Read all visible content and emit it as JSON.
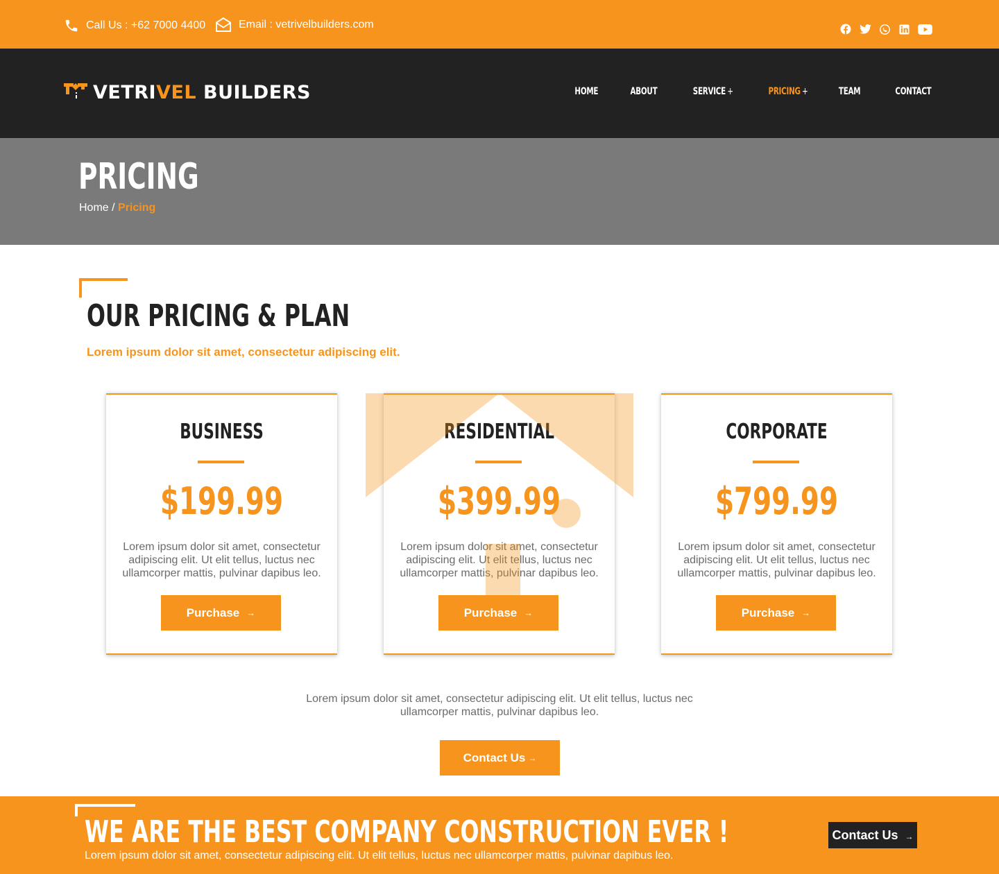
{
  "topbar": {
    "phone_text": "Call Us : +62 7000 4400",
    "email_text": "Email : vetrivelbuilders.com",
    "socials": [
      "facebook-icon",
      "twitter-icon",
      "whatsapp-icon",
      "linkedin-icon",
      "youtube-icon"
    ]
  },
  "brand": {
    "part1": "VETRI",
    "part2": "VEL",
    "part3": " BUILDERS",
    "accent_color": "#F7941D",
    "dark_color": "#222222"
  },
  "nav": {
    "items": [
      {
        "label": "HOME",
        "plus": ""
      },
      {
        "label": "ABOUT",
        "plus": ""
      },
      {
        "label": "SERVICE",
        "plus": "+"
      },
      {
        "label": "PRICING",
        "plus": "+"
      },
      {
        "label": "TEAM",
        "plus": ""
      },
      {
        "label": "CONTACT",
        "plus": ""
      }
    ],
    "active": "PRICING"
  },
  "banner": {
    "title": "PRICING",
    "breadcrumb_home": "Home",
    "breadcrumb_sep": " / ",
    "breadcrumb_current": "Pricing"
  },
  "section": {
    "title": "OUR PRICING & PLAN",
    "subtitle": "Lorem ipsum dolor sit amet, consectetur adipiscing elit."
  },
  "plans": [
    {
      "name": "BUSINESS",
      "price": "$199.99",
      "description": "Lorem ipsum dolor sit amet, consectetur adipiscing elit. Ut elit tellus, luctus nec ullamcorper mattis, pulvinar dapibus leo.",
      "button": "Purchase",
      "arrow": "→"
    },
    {
      "name": "RESIDENTIAL",
      "price": "$399.99",
      "description": "Lorem ipsum dolor sit amet, consectetur adipiscing elit. Ut elit tellus, luctus nec ullamcorper mattis, pulvinar dapibus leo.",
      "button": "Purchase",
      "arrow": "→"
    },
    {
      "name": "CORPORATE",
      "price": "$799.99",
      "description": "Lorem ipsum dolor sit amet, consectetur adipiscing elit. Ut elit tellus, luctus nec ullamcorper mattis, pulvinar dapibus leo.",
      "button": "Purchase",
      "arrow": "→"
    }
  ],
  "middle": {
    "text": "Lorem ipsum dolor sit amet, consectetur adipiscing elit. Ut elit tellus, luctus nec ullamcorper mattis, pulvinar dapibus leo.",
    "button": "Contact Us",
    "arrow": "→"
  },
  "cta": {
    "title": "WE ARE THE BEST COMPANY CONSTRUCTION EVER !",
    "text": "Lorem ipsum dolor sit amet, consectetur adipiscing elit. Ut elit tellus, luctus nec ullamcorper mattis, pulvinar dapibus leo.",
    "button": "Contact Us",
    "arrow": "→"
  }
}
